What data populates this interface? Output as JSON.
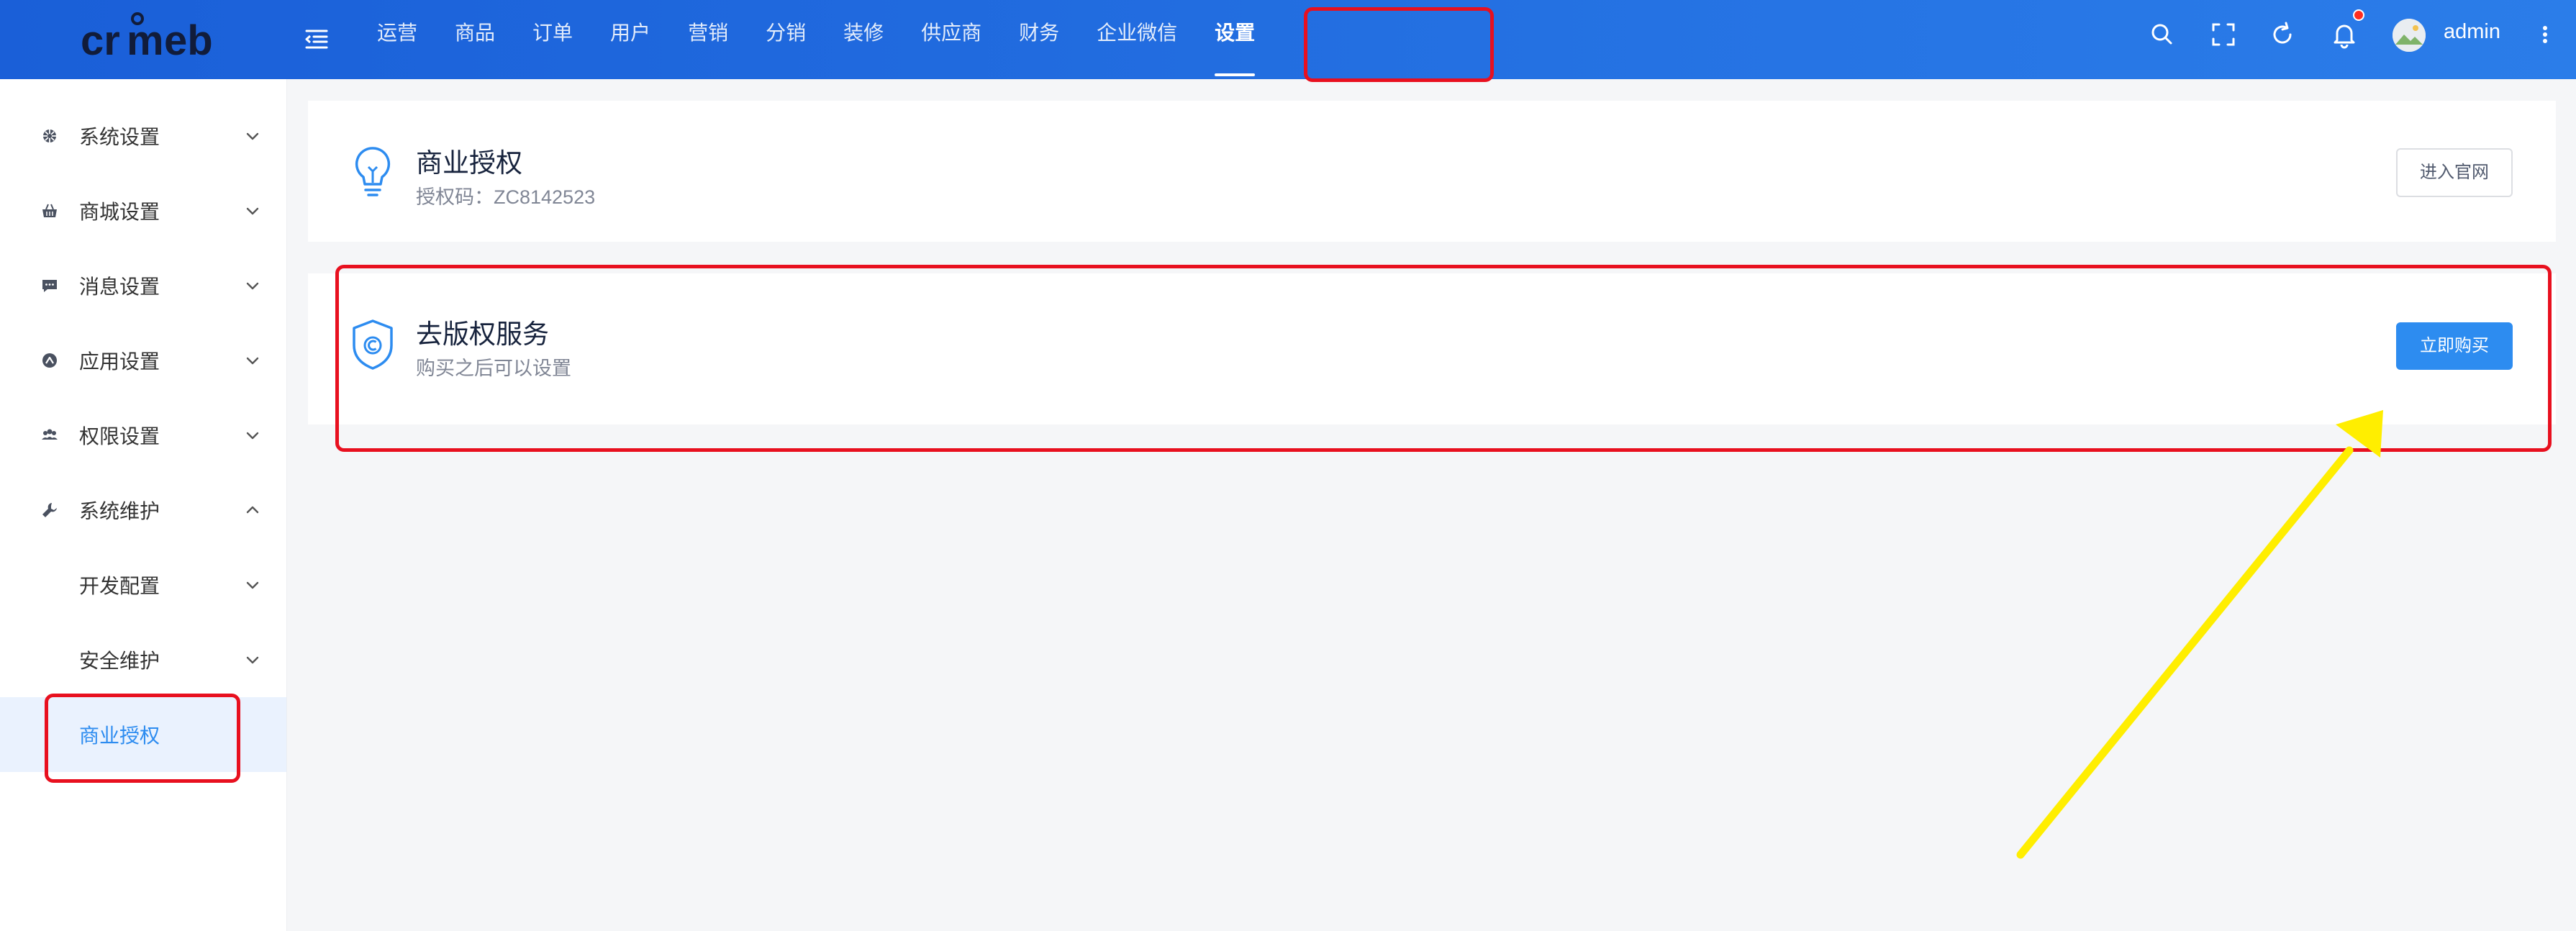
{
  "brand": {
    "logo_text": "crmeb"
  },
  "header": {
    "nav": [
      "运营",
      "商品",
      "订单",
      "用户",
      "营销",
      "分销",
      "装修",
      "供应商",
      "财务",
      "企业微信",
      "设置"
    ],
    "active_nav": "设置",
    "username": "admin",
    "icons": [
      "menu-fold-icon",
      "search-icon",
      "fullscreen-icon",
      "refresh-icon",
      "bell-icon",
      "avatar",
      "more-vertical-icon"
    ],
    "notification_dot_color": "#ff2d20"
  },
  "sidebar": {
    "items": [
      {
        "label": "系统设置",
        "icon": "settings-wheel-icon",
        "expanded": false
      },
      {
        "label": "商城设置",
        "icon": "basket-icon",
        "expanded": false
      },
      {
        "label": "消息设置",
        "icon": "message-icon",
        "expanded": false
      },
      {
        "label": "应用设置",
        "icon": "app-icon",
        "expanded": false
      },
      {
        "label": "权限设置",
        "icon": "group-icon",
        "expanded": false
      },
      {
        "label": "系统维护",
        "icon": "wrench-icon",
        "expanded": true
      }
    ],
    "subitems": [
      {
        "label": "开发配置",
        "expanded": false
      },
      {
        "label": "安全维护",
        "expanded": false
      },
      {
        "label": "商业授权",
        "active": true
      }
    ]
  },
  "cards": {
    "license": {
      "title": "商业授权",
      "subtitle": "授权码：ZC8142523",
      "button": "进入官网",
      "icon": "lightbulb-icon"
    },
    "copyright": {
      "title": "去版权服务",
      "subtitle": "购买之后可以设置",
      "button": "立即购买",
      "icon": "shield-copyright-icon"
    }
  },
  "colors": {
    "header_start": "#1a5fd8",
    "header_end": "#2b7de9",
    "primary": "#2d8cf0",
    "annotation_box": "#e8101f",
    "annotation_arrow": "#ffee00",
    "page_bg": "#f5f6f8"
  }
}
